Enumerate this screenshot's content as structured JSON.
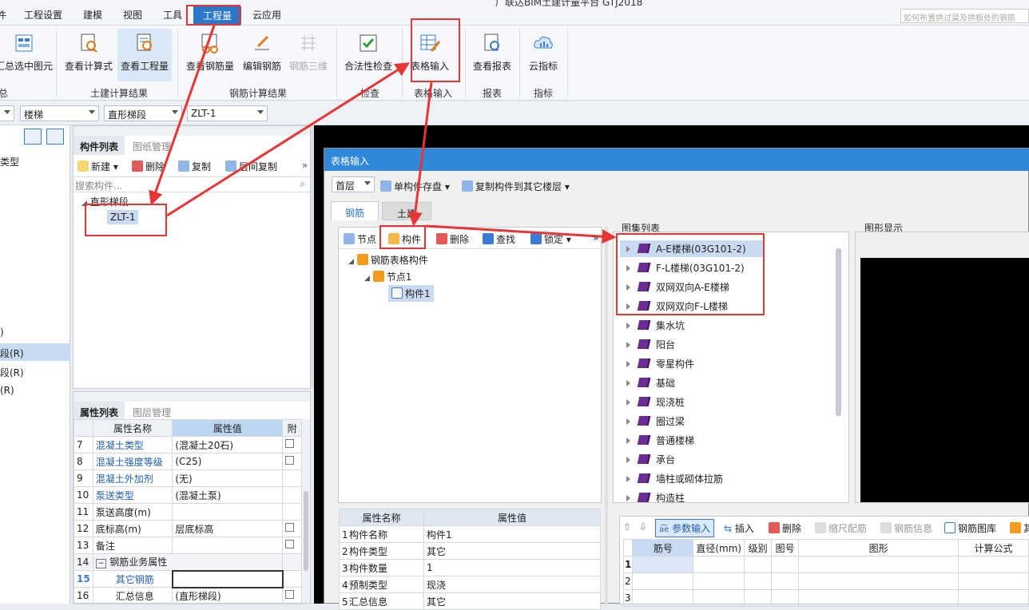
{
  "title": "广联达BIM土建计量平台 GTJ2018",
  "menu": {
    "items": [
      "件",
      "工程设置",
      "建模",
      "视图",
      "工具",
      "工程量",
      "云应用"
    ],
    "active_index": 5,
    "search_placeholder": "如何布置拱过梁及拱板处的钢筋"
  },
  "ribbon": {
    "buttons": [
      {
        "label": "汇总选中图元",
        "icon": "summary-icon"
      },
      {
        "label": "查看计算式",
        "icon": "view-formula-icon"
      },
      {
        "label": "查看工程量",
        "icon": "view-quantity-icon"
      },
      {
        "label": "查看钢筋量",
        "icon": "view-rebar-icon"
      },
      {
        "label": "编辑钢筋",
        "icon": "edit-rebar-icon"
      },
      {
        "label": "钢筋三维",
        "icon": "rebar-3d-icon"
      },
      {
        "label": "合法性检查",
        "icon": "check-icon"
      },
      {
        "label": "表格输入",
        "icon": "table-input-icon"
      },
      {
        "label": "查看报表",
        "icon": "report-icon"
      },
      {
        "label": "云指标",
        "icon": "cloud-index-icon"
      }
    ],
    "groups": [
      "总",
      "土建计算结果",
      "钢筋计算结果",
      "检查",
      "表格输入",
      "报表",
      "指标"
    ]
  },
  "selectors": {
    "layer": "楼梯",
    "type": "直形梯段",
    "component": "ZLT-1"
  },
  "left_col": {
    "items": [
      "类型",
      ")",
      "段(R)",
      "段(R)",
      "(R)"
    ]
  },
  "component_list": {
    "tabs": [
      "构件列表",
      "图纸管理"
    ],
    "toolbar": [
      "新建",
      "删除",
      "复制",
      "层间复制"
    ],
    "search_placeholder": "搜索构件...",
    "tree_parent": "直形梯段",
    "tree_child": "ZLT-1"
  },
  "property_list": {
    "tabs": [
      "属性列表",
      "图层管理"
    ],
    "headers": [
      "属性名称",
      "属性值",
      "附"
    ],
    "rows": [
      {
        "no": "7",
        "name": "混凝土类型",
        "value": "(混凝土20石)",
        "link": true
      },
      {
        "no": "8",
        "name": "混凝土强度等级",
        "value": "(C25)",
        "link": true
      },
      {
        "no": "9",
        "name": "混凝土外加剂",
        "value": "(无)",
        "link": true
      },
      {
        "no": "10",
        "name": "泵送类型",
        "value": "(混凝土泵)",
        "link": true
      },
      {
        "no": "11",
        "name": "泵送高度(m)",
        "value": "",
        "link": false
      },
      {
        "no": "12",
        "name": "底标高(m)",
        "value": "层底标高",
        "link": false
      },
      {
        "no": "13",
        "name": "备注",
        "value": "",
        "link": false
      },
      {
        "no": "14",
        "name": "钢筋业务属性",
        "value": "",
        "link": false
      },
      {
        "no": "15",
        "name": "其它钢筋",
        "value": "",
        "link": true
      },
      {
        "no": "16",
        "name": "汇总信息",
        "value": "(直形梯段)",
        "link": false
      }
    ]
  },
  "dialog": {
    "title": "表格输入",
    "floor": "首层",
    "save_label": "单构件存盘",
    "copy_label": "复制构件到其它楼层",
    "tabs": [
      "钢筋",
      "土建"
    ],
    "toolbar": [
      "节点",
      "构件",
      "删除",
      "查找",
      "锁定"
    ],
    "tree": {
      "root": "钢筋表格构件",
      "node": "节点1",
      "leaf": "构件1"
    },
    "atlas_title": "图集列表",
    "atlas_items": [
      "A-E楼梯(03G101-2)",
      "F-L楼梯(03G101-2)",
      "双网双向A-E楼梯",
      "双网双向F-L楼梯",
      "集水坑",
      "阳台",
      "零星构件",
      "基础",
      "现浇桩",
      "圈过梁",
      "普通楼梯",
      "承台",
      "墙柱或砌体拉筋",
      "构造柱"
    ],
    "graphic_title": "图形显示",
    "prop_headers": [
      "属性名称",
      "属性值"
    ],
    "props": [
      {
        "no": "1",
        "name": "构件名称",
        "value": "构件1"
      },
      {
        "no": "2",
        "name": "构件类型",
        "value": "其它"
      },
      {
        "no": "3",
        "name": "构件数量",
        "value": "1"
      },
      {
        "no": "4",
        "name": "预制类型",
        "value": "现浇"
      },
      {
        "no": "5",
        "name": "汇总信息",
        "value": "其它"
      }
    ],
    "rebar_toolbar": [
      "参数输入",
      "插入",
      "删除",
      "缩尺配筋",
      "钢筋信息",
      "钢筋图库",
      "其"
    ],
    "rebar_headers": [
      "筋号",
      "直径(mm)",
      "级别",
      "图号",
      "图形",
      "计算公式"
    ],
    "rebar_rows": [
      "1",
      "2",
      "3"
    ]
  },
  "colors": {
    "accent": "#2a78c7",
    "annotation": "#e53535",
    "dialog_title": "#2f88d9"
  }
}
